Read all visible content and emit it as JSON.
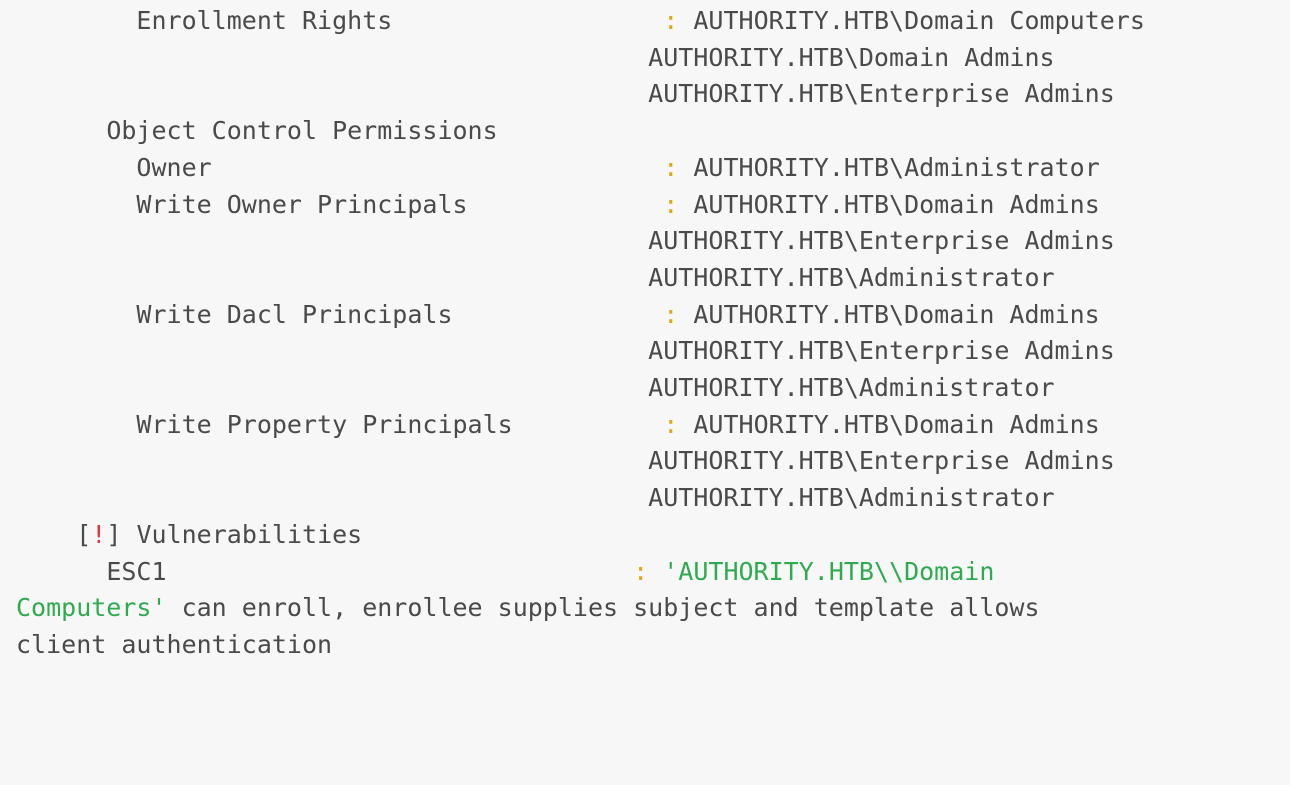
{
  "colors": {
    "background": "#f7f7f7",
    "text": "#4a4a4a",
    "separator_colon": "#e8a317",
    "alert_bang": "#d9363e",
    "string_literal": "#2eab4f"
  },
  "separator": ":",
  "template": {
    "enrollment_rights": {
      "label": "Enrollment Rights",
      "values": [
        "AUTHORITY.HTB\\Domain Computers",
        "AUTHORITY.HTB\\Domain Admins",
        "AUTHORITY.HTB\\Enterprise Admins"
      ]
    },
    "object_control": {
      "heading": "Object Control Permissions",
      "owner": {
        "label": "Owner",
        "values": [
          "AUTHORITY.HTB\\Administrator"
        ]
      },
      "write_owner": {
        "label": "Write Owner Principals",
        "values": [
          "AUTHORITY.HTB\\Domain Admins",
          "AUTHORITY.HTB\\Enterprise Admins",
          "AUTHORITY.HTB\\Administrator"
        ]
      },
      "write_dacl": {
        "label": "Write Dacl Principals",
        "values": [
          "AUTHORITY.HTB\\Domain Admins",
          "AUTHORITY.HTB\\Enterprise Admins",
          "AUTHORITY.HTB\\Administrator"
        ]
      },
      "write_property": {
        "label": "Write Property Principals",
        "values": [
          "AUTHORITY.HTB\\Domain Admins",
          "AUTHORITY.HTB\\Enterprise Admins",
          "AUTHORITY.HTB\\Administrator"
        ]
      }
    },
    "vulnerabilities": {
      "bracket_open": "[",
      "bang": "!",
      "bracket_close": "]",
      "heading": "Vulnerabilities",
      "esc1": {
        "label": "ESC1",
        "string_part1": "'AUTHORITY.HTB\\\\Domain",
        "string_part2": "Computers'",
        "tail_line1": "can enroll, enrollee supplies subject and template allows",
        "tail_line2": "client authentication"
      }
    }
  }
}
